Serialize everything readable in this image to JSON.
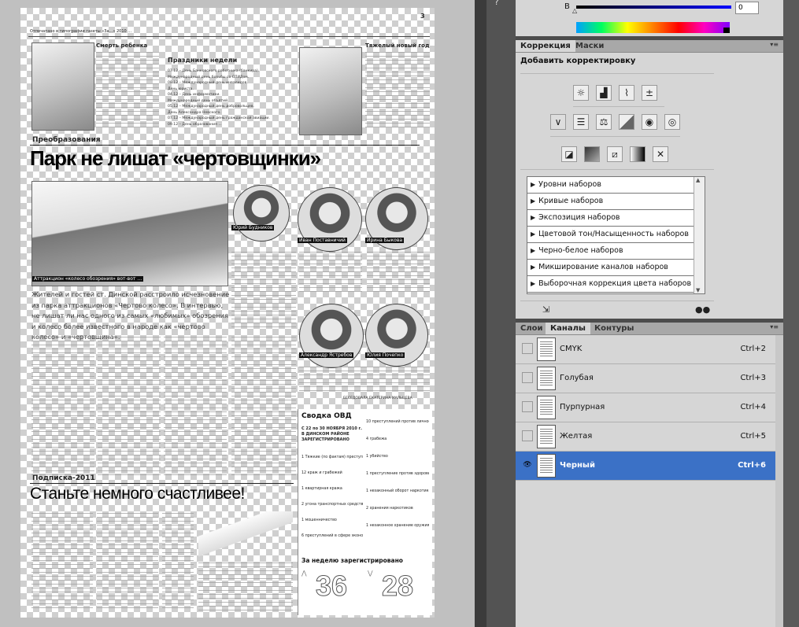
{
  "colors": {
    "accent": "#3b71c6",
    "panel_bg": "#d6d6d6",
    "tab_bar": "#a8a8a8"
  },
  "document": {
    "page_number": "3",
    "header_line": "Отпечатано в типографии газеты «За...» 2010 ...",
    "announcements": {
      "left_title": "Смерть ребенка",
      "center_title": "Праздники недели",
      "right_title": "Тяжелый новый год",
      "holidays": [
        "07.12 – День Банковского работника (банкира).",
        "Международный день борьбы со СПИДом.",
        "08.12 – Международный день инвалидов.",
        "День юриста.",
        "04.12 – День информатики.",
        "Международный день объятий.",
        "05.12 – Международный день добровольцев.",
        "День Александра Невского.",
        "07.12 – Международный день гражданской авиации.",
        "09.12 – День образования ..."
      ]
    },
    "section1": "Преобразования",
    "headline1": "Парк не лишат «чертовщинки»",
    "photo_caption": "Аттракцион «колесо обозрения» вот-вот …",
    "lead": "Жителей и гостей ст. Динской расстроило исчезновение из парка аттракционов «Чертово колесо». В интервью, не лишат ли нас одного из самых «любимых» обозрения и колесо более известного в народе как «чертово колесо» и «чертовщина».",
    "portraits": [
      "Юрий Будников",
      "Иван Поставничий",
      "Ирина Быкова",
      "Александр Ястребов",
      "Юлия Почепко"
    ],
    "signature": "БЕСЕДОВАЛА ЕКАТЕРИНА МАЛЬЦЕВА",
    "section2": "Подписка-2011",
    "headline2": "Станьте немного счастливее!",
    "ovd": {
      "title": "Сводка ОВД",
      "subtitle": "С 22 по 30 НОЯБРЯ 2010 г. В ДИНСКОМ РАЙОНЕ ЗАРЕГИСТРИРОВАНО",
      "left_items": [
        "1 Тяжкие (по фактам) преступлений",
        "12 краж и грабежей",
        "1 квартирная кража",
        "2 угона транспортных средств",
        "1 мошенничество",
        "6 преступлений в сфере экономики"
      ],
      "right_items": [
        "10 преступлений против личности",
        "4 грабежа",
        "1 убийство",
        "1 преступление против здоровья населения",
        "1 незаконный оборот наркотиков",
        "2 хранения наркотиков",
        "1 незаконное хранение оружия"
      ],
      "week_title": "За неделю зарегистрировано",
      "week_numbers": [
        "36",
        "28"
      ]
    }
  },
  "panels": {
    "color": {
      "channel_label": "В",
      "value": "0",
      "top_icon": "?"
    },
    "adjustments": {
      "tabs": [
        "Коррекция",
        "Маски"
      ],
      "header": "Добавить корректировку",
      "presets": [
        "Уровни наборов",
        "Кривые наборов",
        "Экспозиция наборов",
        "Цветовой тон/Насыщенность наборов",
        "Черно-белое наборов",
        "Микширование каналов наборов",
        "Выборочная коррекция цвета наборов"
      ]
    },
    "channels": {
      "tabs": [
        "Слои",
        "Каналы",
        "Контуры"
      ],
      "rows": [
        {
          "name": "CMYK",
          "key": "Ctrl+2"
        },
        {
          "name": "Голубая",
          "key": "Ctrl+3"
        },
        {
          "name": "Пурпурная",
          "key": "Ctrl+4"
        },
        {
          "name": "Желтая",
          "key": "Ctrl+5"
        },
        {
          "name": "Черный",
          "key": "Ctrl+6"
        }
      ]
    }
  }
}
